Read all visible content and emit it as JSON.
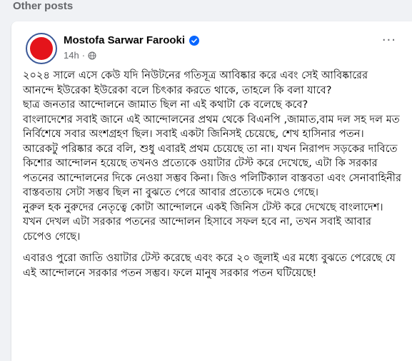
{
  "section": {
    "title": "Other posts"
  },
  "post": {
    "author": "Mostofa Sarwar Farooki",
    "time": "14h",
    "separator": "·",
    "more_label": "···",
    "paragraphs": [
      "২০২৪ সালে এসে কেউ যদি নিউটনের গতিসূত্র আবিষ্কার করে এবং সেই আবিষ্কারের আনন্দে ইউরেকা ইউরেকা বলে চিৎকার করতে থাকে, তাহলে কি বলা যাবে?",
      "ছাত্র জনতার আন্দোলনে জামাত ছিল না এই কথাটা কে বলেছে কবে?",
      " বাংলাদেশের সবাই জানে এই আন্দোলনের প্রথম থেকে বিএনপি ,জামাত,বাম দল সহ দল মত নির্বিশেষে সবার অংশগ্রহণ ছিল। সবাই একটা জিনিসই চেয়েছে, শেখ হাসিনার পতন।",
      "আরেকটু পরিষ্কার করে বলি, শুধু এবারই প্রথম চেয়েছে তা না। যখন নিরাপদ সড়কের দাবিতে কিশোর আন্দোলন হয়েছে তখনও প্রত্যেকে ওয়াটার টেস্ট করে দেখেছে, এটা কি সরকার পতনের আন্দোলনের দিকে নেওয়া সম্ভব কিনা। জিও পলিটিক্যাল বাস্তবতা এবং সেনাবাহিনীর বাস্তবতায় সেটা সম্ভব ছিল না বুঝতে পেরে আবার প্রত্যেকে দমেও গেছে।",
      "নুরুল হক নুরুদের নেতৃত্বে কোটা আন্দোলনে একই জিনিস টেস্ট করে দেখেছে বাংলাদেশ। যখন দেখল এটা সরকার পতনের আন্দোলন হিসাবে সফল হবে না, তখন সবাই আবার চেপেও গেছে।",
      "এবারও পুরো জাতি ওয়াটার টেস্ট করেছে এবং করে ২০ জুলাই এর মধ্যে বুঝতে পেরেছে যে এই আন্দোলনে সরকার পতন সম্ভব। ফলে মানুষ সরকার পতন ঘটিয়েছে!"
    ]
  },
  "colors": {
    "page_bg": "#f0f2f5",
    "card_bg": "#ffffff",
    "avatar_fill": "#e4141b",
    "avatar_ring": "#3b5998",
    "verified": "#0866ff",
    "meta": "#65676b"
  },
  "icons": {
    "verified": "verified-badge-icon",
    "globe": "globe-icon",
    "more": "more-options-icon"
  }
}
